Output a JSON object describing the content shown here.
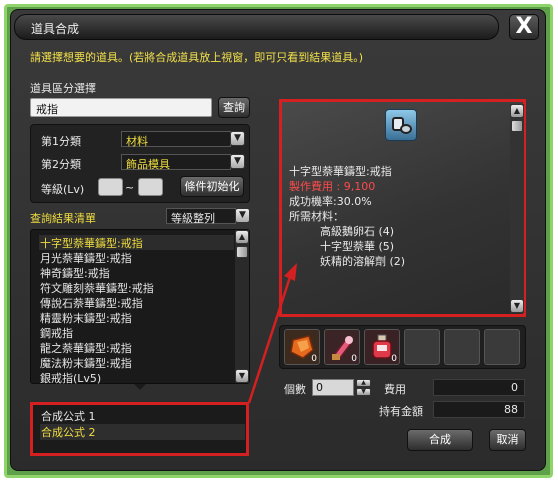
{
  "window": {
    "title": "道具合成",
    "close_label": "X",
    "instruction": "請選擇想要的道具。(若將合成道具放上視窗，即可只看到結果道具。)"
  },
  "search": {
    "section_label": "道具區分選擇",
    "value": "戒指",
    "button_label": "查詢"
  },
  "categories": {
    "first_label": "第1分類",
    "first_value": "材料",
    "second_label": "第2分類",
    "second_value": "飾品模具",
    "level_label": "等級(Lv)",
    "level_sep": "~",
    "reset_label": "條件初始化"
  },
  "results": {
    "header": "查詢結果清單",
    "sort_label": "等級整列",
    "items": [
      "十字型萘華鑄型:戒指",
      "月光萘華鑄型:戒指",
      "神奇鑄型:戒指",
      "符文雕刻萘華鑄型:戒指",
      "傳說石萘華鑄型:戒指",
      "精靈粉末鑄型:戒指",
      "鋼戒指",
      "龍之萘華鑄型:戒指",
      "魔法粉末鑄型:戒指",
      "銀戒指(Lv5)"
    ],
    "selected_index": 0
  },
  "formulas": {
    "items": [
      "合成公式 1",
      "合成公式 2"
    ],
    "selected_index": 1
  },
  "detail": {
    "name": "十字型萘華鑄型:戒指",
    "cost": "製作費用 : 9,100",
    "success_rate": "成功機率:30.0%",
    "materials_label": "所需材料：",
    "materials": [
      "高級鵝卵石 (4)",
      "十字型萘華 (5)",
      "妖精的溶解劑 (2)"
    ]
  },
  "slots": [
    {
      "icon": "orange-stone-icon",
      "count": "0"
    },
    {
      "icon": "crystal-powder-icon",
      "count": "0"
    },
    {
      "icon": "red-potion-icon",
      "count": "0"
    }
  ],
  "footer": {
    "qty_label": "個數",
    "qty_value": "0",
    "fee_label": "費用",
    "fee_value": "0",
    "money_label": "持有金額",
    "money_value": "88",
    "craft_label": "合成",
    "cancel_label": "取消"
  },
  "colors": {
    "highlight_red": "#d42020",
    "text_yellow": "#f0dd40",
    "frame_green": "#8fd46a"
  }
}
